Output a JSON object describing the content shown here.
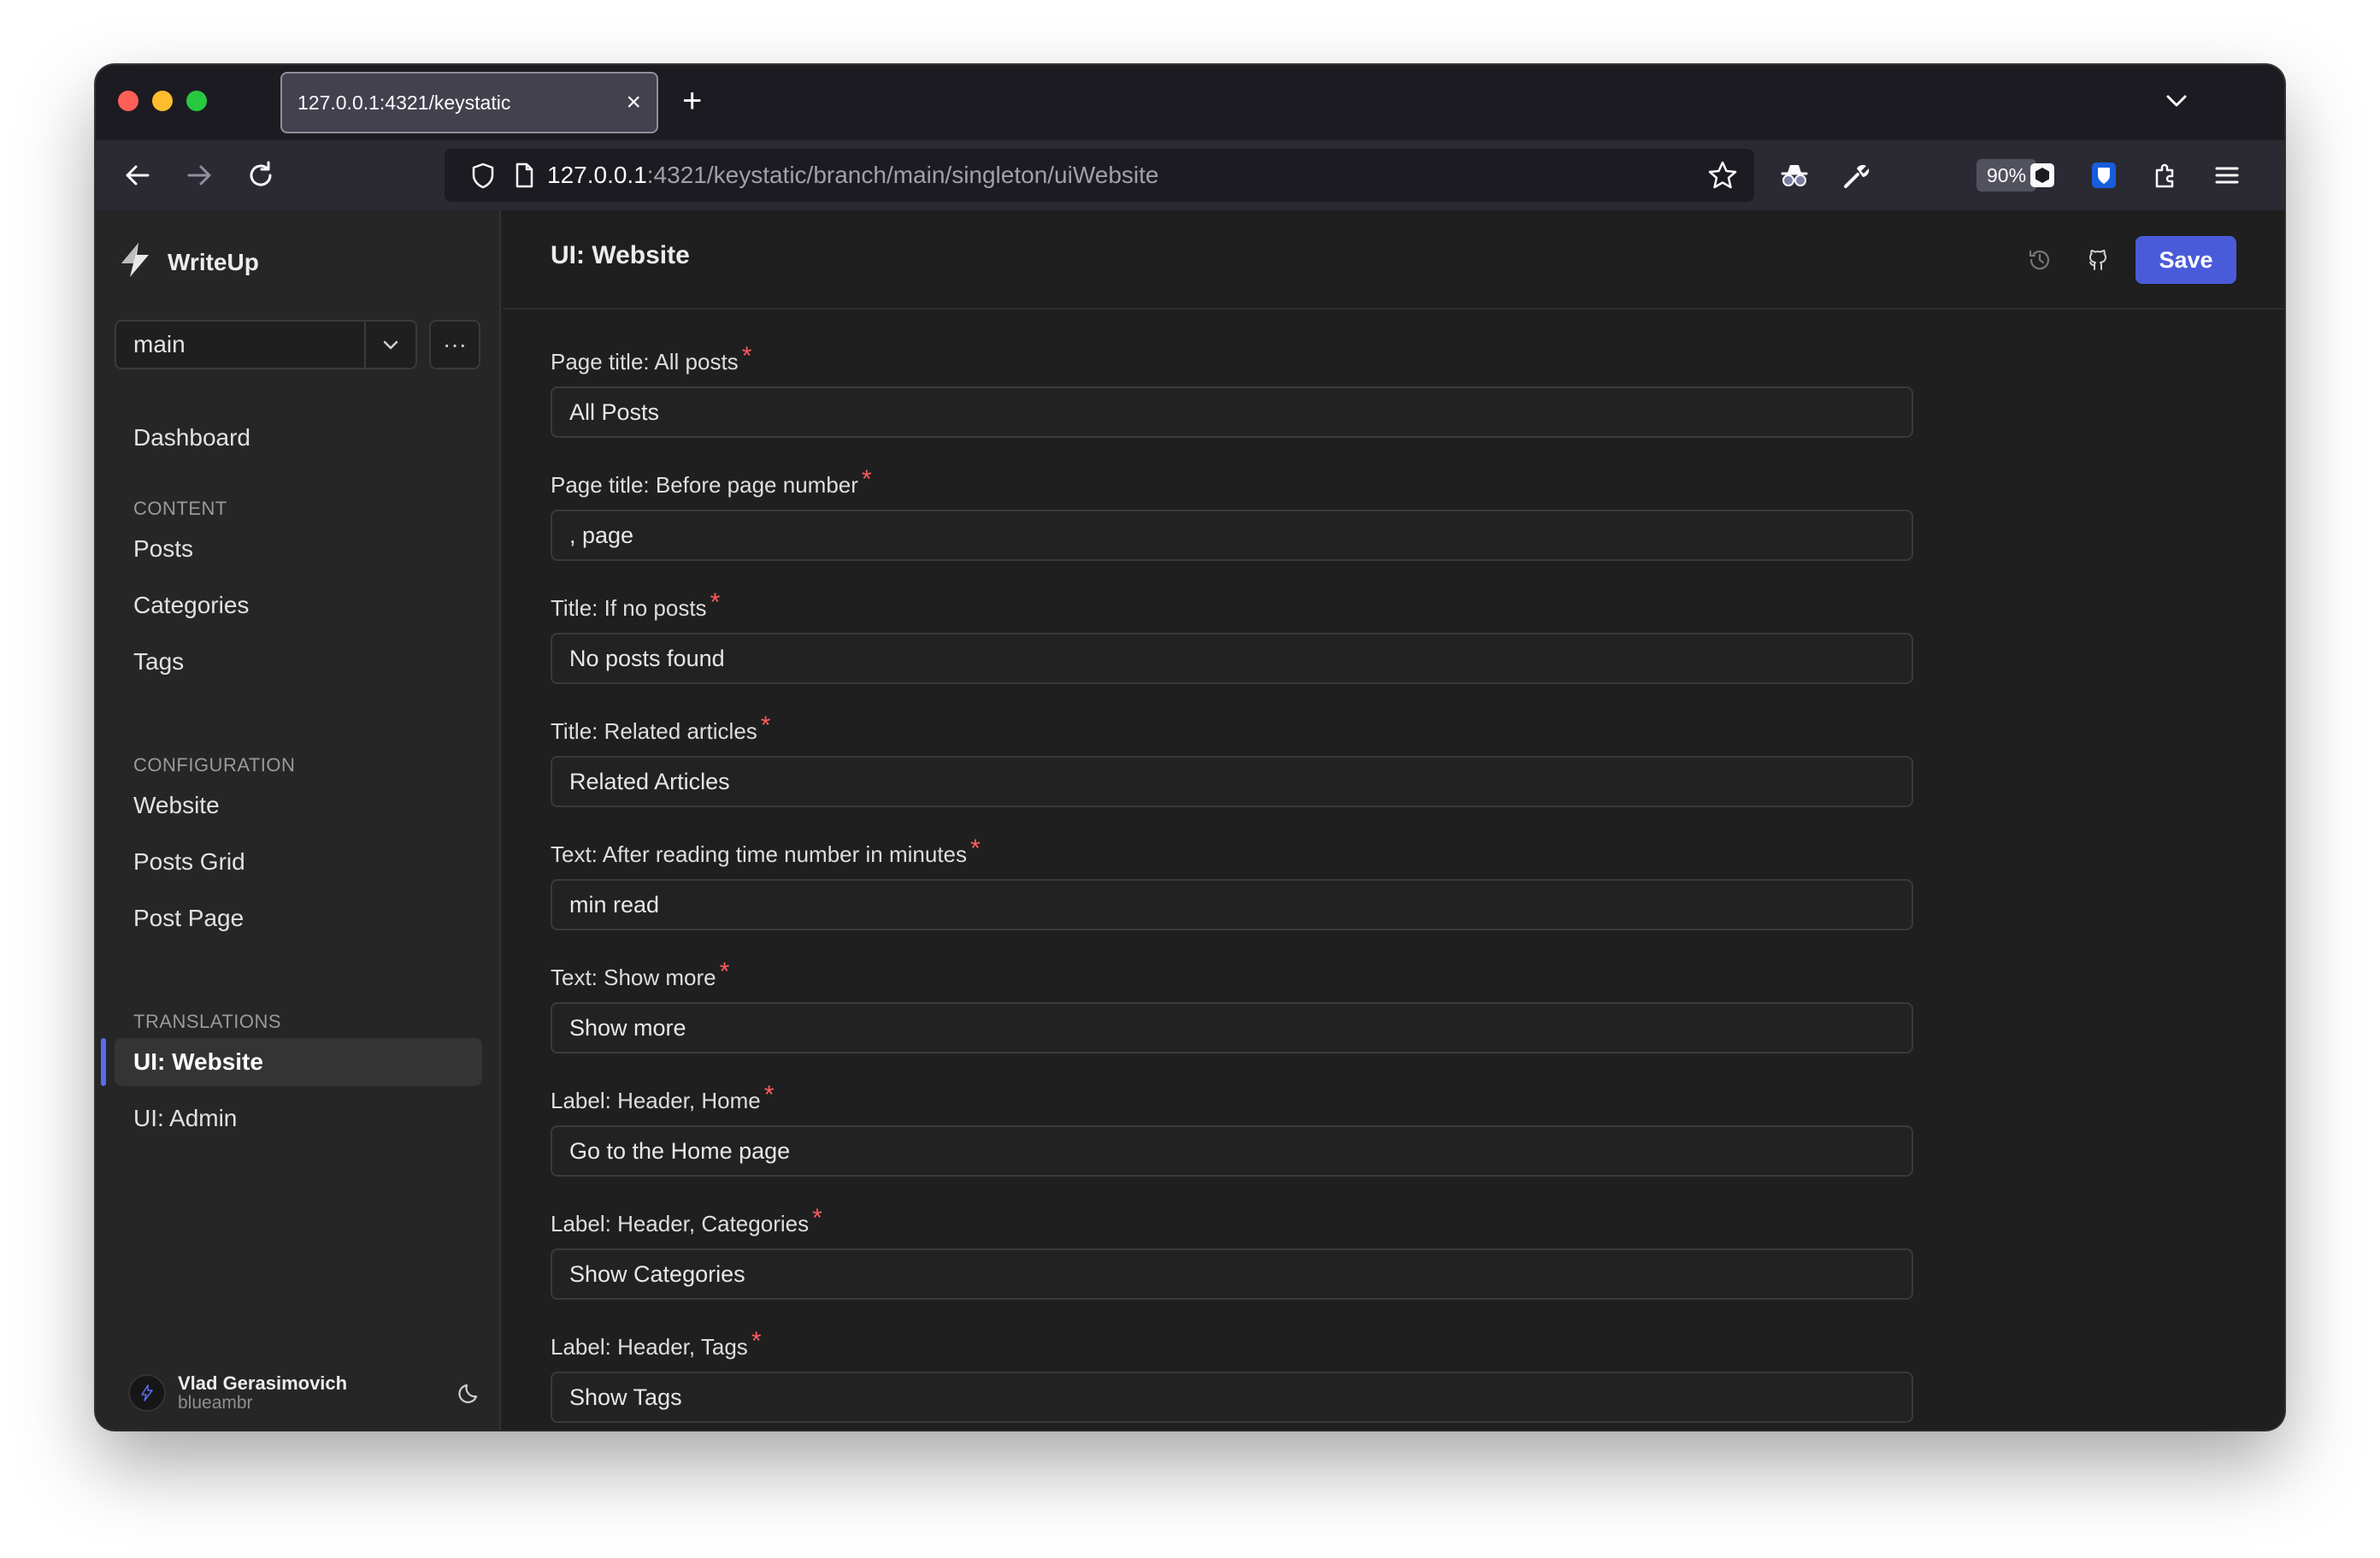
{
  "browser": {
    "tab_title": "127.0.0.1:4321/keystatic",
    "url_host": "127.0.0.1",
    "url_path": ":4321/keystatic/branch/main/singleton/uiWebsite",
    "zoom": "90%"
  },
  "sidebar": {
    "brand": "WriteUp",
    "branch": "main",
    "dashboard": "Dashboard",
    "sections": {
      "content": "CONTENT",
      "configuration": "CONFIGURATION",
      "translations": "TRANSLATIONS"
    },
    "content_items": [
      "Posts",
      "Categories",
      "Tags"
    ],
    "configuration_items": [
      "Website",
      "Posts Grid",
      "Post Page"
    ],
    "translation_items": [
      "UI: Website",
      "UI: Admin"
    ],
    "user": {
      "name": "Vlad Gerasimovich",
      "handle": "blueambr"
    }
  },
  "main": {
    "title": "UI: Website",
    "save_label": "Save",
    "fields": [
      {
        "label": "Page title: All posts",
        "value": "All Posts"
      },
      {
        "label": "Page title: Before page number",
        "value": ", page"
      },
      {
        "label": "Title: If no posts",
        "value": "No posts found"
      },
      {
        "label": "Title: Related articles",
        "value": "Related Articles"
      },
      {
        "label": "Text: After reading time number in minutes",
        "value": "min read"
      },
      {
        "label": "Text: Show more",
        "value": "Show more"
      },
      {
        "label": "Label: Header, Home",
        "value": "Go to the Home page"
      },
      {
        "label": "Label: Header, Categories",
        "value": "Show Categories"
      },
      {
        "label": "Label: Header, Tags",
        "value": "Show Tags"
      }
    ],
    "required_mark": "*"
  },
  "colors": {
    "accent": "#4a5bd9",
    "required": "#ff5c5c",
    "active_indicator": "#5a6cf0"
  }
}
